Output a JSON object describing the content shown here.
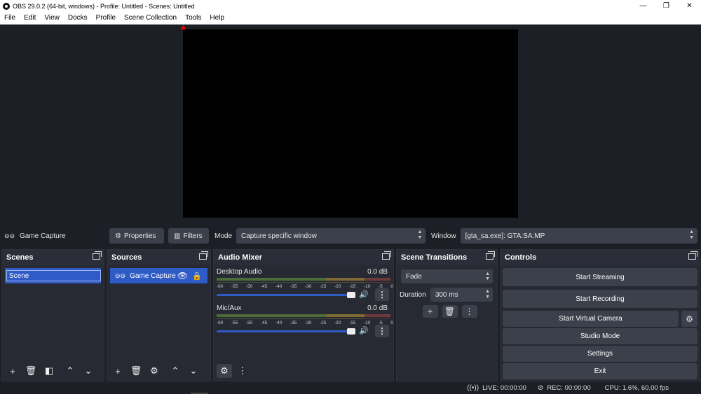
{
  "window": {
    "title": "OBS 29.0.2 (64-bit, windows) - Profile: Untitled - Scenes: Untitled",
    "minimize_glyph": "—",
    "maximize_glyph": "❐",
    "close_glyph": "✕"
  },
  "menu": [
    "File",
    "Edit",
    "View",
    "Docks",
    "Profile",
    "Scene Collection",
    "Tools",
    "Help"
  ],
  "context_bar": {
    "source_name": "Game Capture",
    "properties_label": "Properties",
    "filters_label": "Filters",
    "mode_label": "Mode",
    "mode_value": "Capture specific window",
    "window_label": "Window",
    "window_value": "[gta_sa.exe]: GTA:SA:MP"
  },
  "scenes": {
    "title": "Scenes",
    "items": [
      "Scene"
    ]
  },
  "sources": {
    "title": "Sources",
    "items": [
      "Game Capture"
    ]
  },
  "audio_mixer": {
    "title": "Audio Mixer",
    "scale": [
      "-60",
      "-55",
      "-50",
      "-45",
      "-40",
      "-35",
      "-30",
      "-25",
      "-20",
      "-15",
      "-10",
      "-5",
      "0"
    ],
    "channels": [
      {
        "name": "Desktop Audio",
        "db": "0.0 dB",
        "volume": 1.0
      },
      {
        "name": "Mic/Aux",
        "db": "0.0 dB",
        "volume": 1.0
      }
    ]
  },
  "scene_transitions": {
    "title": "Scene Transitions",
    "transition": "Fade",
    "duration_label": "Duration",
    "duration_value": "300 ms"
  },
  "controls": {
    "title": "Controls",
    "start_streaming": "Start Streaming",
    "start_recording": "Start Recording",
    "start_virtual_camera": "Start Virtual Camera",
    "studio_mode": "Studio Mode",
    "settings": "Settings",
    "exit": "Exit"
  },
  "status": {
    "live": "LIVE: 00:00:00",
    "rec": "REC: 00:00:00",
    "cpu": "CPU: 1.6%, 60.00 fps"
  },
  "colors": {
    "accent": "#2f5bc7",
    "background": "#1d1f26",
    "panel": "#272a33",
    "button": "#3c404b"
  }
}
